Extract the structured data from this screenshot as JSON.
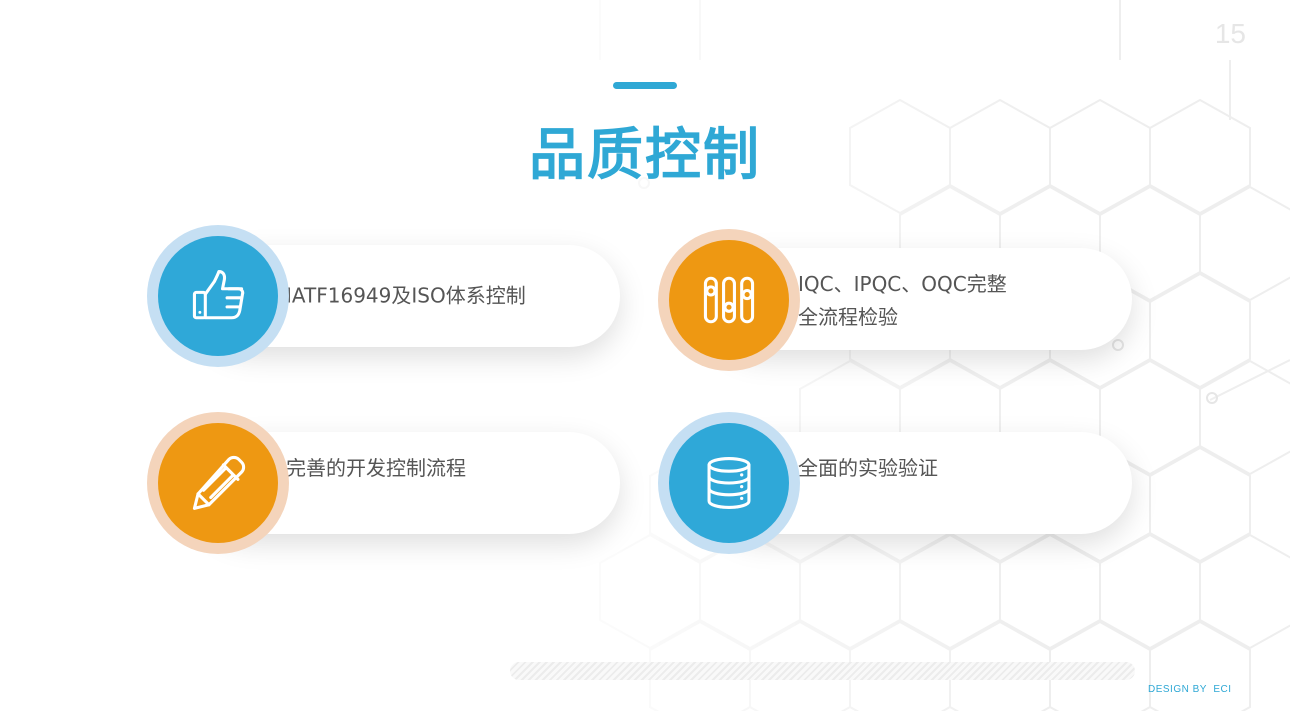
{
  "slide": {
    "page_number": "15",
    "title": "品质控制",
    "credit": "DESIGN BY  ECI"
  },
  "colors": {
    "accent_blue": "#2fa8d5",
    "accent_orange": "#ee9812",
    "text_gray": "#555555"
  },
  "items": [
    {
      "lines": [
        "IATF16949及ISO体系控制"
      ],
      "icon": "thumbs-up-icon",
      "color": "blue"
    },
    {
      "lines": [
        "IQC、IPQC、OQC完整",
        "全流程检验"
      ],
      "icon": "sliders-icon",
      "color": "orange"
    },
    {
      "lines": [
        "完善的开发控制流程"
      ],
      "icon": "pencil-icon",
      "color": "orange"
    },
    {
      "lines": [
        "全面的实验验证"
      ],
      "icon": "database-icon",
      "color": "blue"
    }
  ]
}
